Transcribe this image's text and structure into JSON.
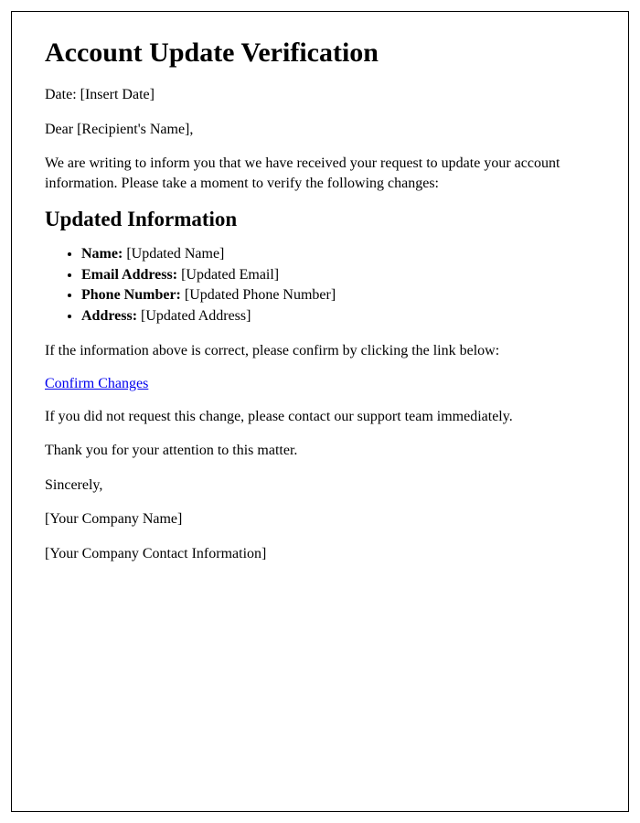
{
  "title": "Account Update Verification",
  "date_line": "Date: [Insert Date]",
  "greeting": "Dear [Recipient's Name],",
  "intro": "We are writing to inform you that we have received your request to update your account information. Please take a moment to verify the following changes:",
  "section_heading": "Updated Information",
  "fields": [
    {
      "label": "Name:",
      "value": " [Updated Name]"
    },
    {
      "label": "Email Address:",
      "value": " [Updated Email]"
    },
    {
      "label": "Phone Number:",
      "value": " [Updated Phone Number]"
    },
    {
      "label": "Address:",
      "value": " [Updated Address]"
    }
  ],
  "confirm_prompt": "If the information above is correct, please confirm by clicking the link below:",
  "confirm_link_text": "Confirm Changes",
  "not_requested": "If you did not request this change, please contact our support team immediately.",
  "thanks": "Thank you for your attention to this matter.",
  "signoff": "Sincerely,",
  "company_name": "[Your Company Name]",
  "company_contact": "[Your Company Contact Information]"
}
